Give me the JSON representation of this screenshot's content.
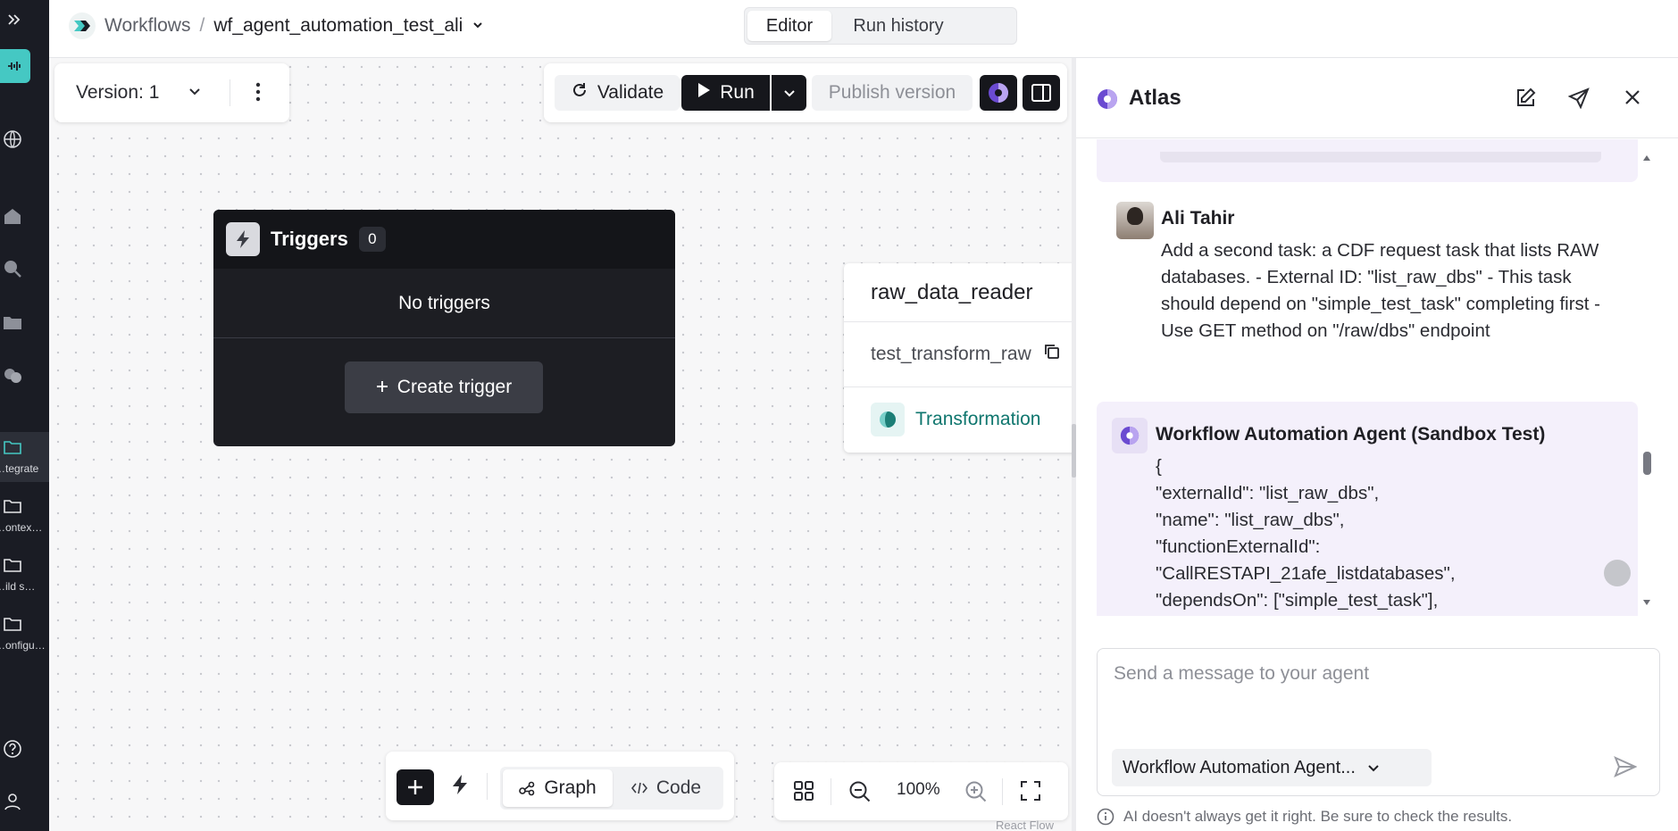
{
  "nav": {
    "items": [
      {
        "label": "…tegrate"
      },
      {
        "label": "…ontex…"
      },
      {
        "label": "…ild s…"
      },
      {
        "label": "…onfigu…"
      }
    ]
  },
  "header": {
    "breadcrumb_root": "Workflows",
    "breadcrumb_sep": "/",
    "workflow_name": "wf_agent_automation_test_ali",
    "tabs": [
      "Editor",
      "Run history"
    ]
  },
  "toolbar": {
    "version_label": "Version: 1",
    "validate_label": "Validate",
    "run_label": "Run",
    "publish_label": "Publish version"
  },
  "triggers_node": {
    "title": "Triggers",
    "count": "0",
    "empty_text": "No triggers",
    "create_label": "Create trigger"
  },
  "task_node": {
    "name": "raw_data_reader",
    "external_id": "test_transform_raw",
    "type_label": "Transformation"
  },
  "bottom_toolbar": {
    "graph_label": "Graph",
    "code_label": "Code",
    "zoom": "100%",
    "attribution": "React Flow"
  },
  "atlas": {
    "title": "Atlas",
    "user_message": {
      "author": "Ali Tahir",
      "text": "Add a second task: a CDF request task that lists RAW databases. - External ID: \"list_raw_dbs\" - This task should depend on \"simple_test_task\" completing first - Use GET method on \"/raw/dbs\" endpoint"
    },
    "agent_message": {
      "author": "Workflow Automation Agent (Sandbox Test)",
      "lines": [
        "{",
        "\"externalId\": \"list_raw_dbs\",",
        "\"name\": \"list_raw_dbs\",",
        "\"functionExternalId\":",
        "\"CallRESTAPI_21afe_listdatabases\",",
        "\"dependsOn\": [\"simple_test_task\"],"
      ]
    },
    "composer_placeholder": "Send a message to your agent",
    "agent_select": "Workflow Automation Agent...",
    "disclaimer": "AI doesn't always get it right. Be sure to check the results."
  },
  "colors": {
    "accent_teal": "#45c8c3",
    "brand_purple": "#6b4bd1",
    "dark": "#16171c"
  }
}
